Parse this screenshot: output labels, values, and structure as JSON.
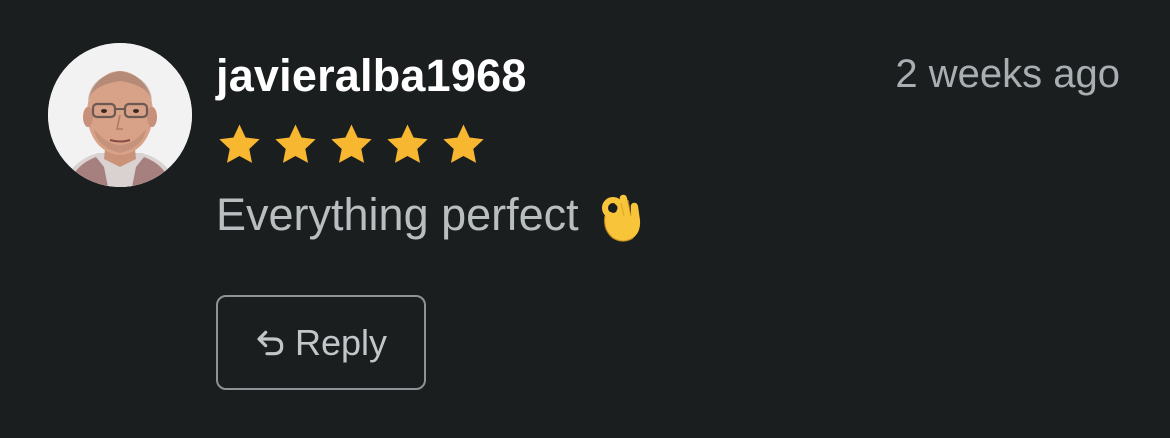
{
  "review": {
    "username": "javieralba1968",
    "timestamp": "2 weeks ago",
    "rating": 5,
    "rating_max": 5,
    "comment": "Everything perfect",
    "comment_emoji": "ok-hand-emoji",
    "reply_label": "Reply",
    "reply_icon": "reply-arrow-icon",
    "star_icon": "star-icon",
    "avatar": "user-avatar-photo"
  },
  "colors": {
    "background": "#1a1e1f",
    "username": "#ffffff",
    "timestamp": "#a8aeb1",
    "comment": "#b9bec0",
    "star": "#f7b731",
    "button_border": "#8d9396",
    "button_text": "#c2c6c8"
  }
}
